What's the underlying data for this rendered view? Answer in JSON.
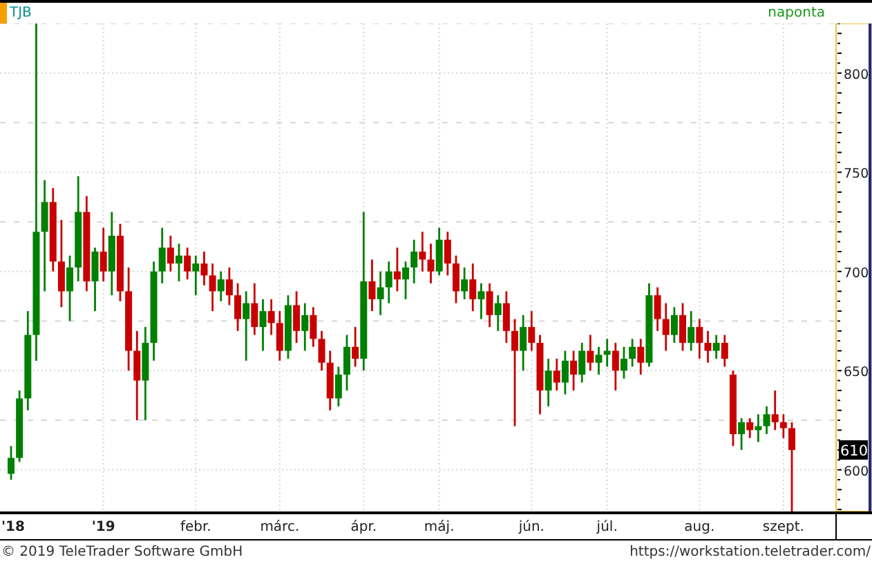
{
  "header": {
    "symbol": "TJB",
    "interval": "naponta"
  },
  "chart": {
    "chart_data": {
      "type": "candlestick",
      "grid": true,
      "ylim": [
        579,
        825
      ],
      "categories": [
        "'18",
        null,
        null,
        null,
        null,
        null,
        null,
        null,
        null,
        null,
        null,
        "'19",
        null,
        null,
        null,
        null,
        null,
        null,
        null,
        null,
        null,
        null,
        "febr.",
        null,
        null,
        null,
        null,
        null,
        null,
        null,
        null,
        null,
        "márc.",
        null,
        null,
        null,
        null,
        null,
        null,
        null,
        null,
        null,
        "ápr.",
        null,
        null,
        null,
        null,
        null,
        null,
        null,
        null,
        "máj.",
        null,
        null,
        null,
        null,
        null,
        null,
        null,
        null,
        null,
        null,
        "jún.",
        null,
        null,
        null,
        null,
        null,
        null,
        null,
        null,
        "júl.",
        null,
        null,
        null,
        null,
        null,
        null,
        null,
        null,
        null,
        null,
        "aug.",
        null,
        null,
        null,
        null,
        null,
        null,
        null,
        null,
        null,
        "szept.",
        null
      ],
      "yticks": [
        600,
        650,
        700,
        750,
        800
      ],
      "annotations": [
        "610"
      ],
      "ohlc": [
        [
          598,
          612,
          595,
          606
        ],
        [
          606,
          640,
          604,
          636
        ],
        [
          636,
          680,
          630,
          668
        ],
        [
          668,
          825,
          655,
          720
        ],
        [
          720,
          746,
          690,
          735
        ],
        [
          735,
          742,
          700,
          705
        ],
        [
          705,
          726,
          682,
          690
        ],
        [
          690,
          708,
          675,
          702
        ],
        [
          702,
          748,
          695,
          730
        ],
        [
          730,
          738,
          690,
          695
        ],
        [
          695,
          712,
          680,
          710
        ],
        [
          710,
          722,
          695,
          700
        ],
        [
          700,
          730,
          688,
          718
        ],
        [
          718,
          724,
          685,
          690
        ],
        [
          690,
          702,
          650,
          660
        ],
        [
          660,
          670,
          625,
          645
        ],
        [
          645,
          672,
          625,
          664
        ],
        [
          664,
          705,
          655,
          700
        ],
        [
          700,
          722,
          694,
          712
        ],
        [
          712,
          718,
          700,
          704
        ],
        [
          704,
          714,
          695,
          708
        ],
        [
          708,
          712,
          696,
          700
        ],
        [
          700,
          708,
          688,
          704
        ],
        [
          704,
          710,
          693,
          698
        ],
        [
          698,
          704,
          680,
          690
        ],
        [
          690,
          700,
          685,
          696
        ],
        [
          696,
          702,
          683,
          688
        ],
        [
          688,
          694,
          670,
          676
        ],
        [
          676,
          690,
          655,
          684
        ],
        [
          684,
          694,
          668,
          672
        ],
        [
          672,
          686,
          660,
          680
        ],
        [
          680,
          686,
          668,
          674
        ],
        [
          674,
          680,
          655,
          660
        ],
        [
          660,
          688,
          656,
          683
        ],
        [
          683,
          690,
          664,
          670
        ],
        [
          670,
          684,
          660,
          678
        ],
        [
          678,
          682,
          662,
          666
        ],
        [
          666,
          670,
          650,
          654
        ],
        [
          654,
          660,
          630,
          636
        ],
        [
          636,
          652,
          632,
          648
        ],
        [
          648,
          668,
          640,
          662
        ],
        [
          662,
          672,
          652,
          656
        ],
        [
          656,
          730,
          650,
          695
        ],
        [
          695,
          706,
          680,
          686
        ],
        [
          686,
          700,
          678,
          692
        ],
        [
          692,
          705,
          684,
          700
        ],
        [
          700,
          712,
          690,
          696
        ],
        [
          696,
          705,
          686,
          702
        ],
        [
          702,
          716,
          694,
          710
        ],
        [
          710,
          720,
          700,
          706
        ],
        [
          706,
          714,
          694,
          700
        ],
        [
          700,
          722,
          698,
          716
        ],
        [
          716,
          720,
          698,
          704
        ],
        [
          704,
          708,
          684,
          690
        ],
        [
          690,
          702,
          686,
          696
        ],
        [
          696,
          704,
          680,
          686
        ],
        [
          686,
          694,
          676,
          690
        ],
        [
          690,
          694,
          672,
          678
        ],
        [
          678,
          688,
          670,
          684
        ],
        [
          684,
          690,
          664,
          670
        ],
        [
          670,
          676,
          622,
          660
        ],
        [
          660,
          678,
          650,
          672
        ],
        [
          672,
          680,
          660,
          664
        ],
        [
          664,
          668,
          628,
          640
        ],
        [
          640,
          656,
          632,
          650
        ],
        [
          650,
          656,
          640,
          644
        ],
        [
          644,
          660,
          638,
          655
        ],
        [
          655,
          660,
          640,
          648
        ],
        [
          648,
          664,
          644,
          660
        ],
        [
          660,
          668,
          650,
          654
        ],
        [
          654,
          662,
          648,
          658
        ],
        [
          658,
          666,
          652,
          660
        ],
        [
          660,
          664,
          640,
          650
        ],
        [
          650,
          662,
          646,
          656
        ],
        [
          656,
          666,
          652,
          662
        ],
        [
          662,
          666,
          648,
          654
        ],
        [
          654,
          694,
          652,
          688
        ],
        [
          688,
          692,
          670,
          676
        ],
        [
          676,
          684,
          660,
          668
        ],
        [
          668,
          682,
          664,
          678
        ],
        [
          678,
          684,
          660,
          664
        ],
        [
          664,
          680,
          660,
          672
        ],
        [
          672,
          676,
          656,
          664
        ],
        [
          664,
          670,
          654,
          660
        ],
        [
          660,
          668,
          656,
          664
        ],
        [
          664,
          668,
          652,
          656
        ],
        [
          648,
          650,
          612,
          618
        ],
        [
          618,
          626,
          610,
          624
        ],
        [
          624,
          626,
          616,
          620
        ],
        [
          620,
          628,
          614,
          622
        ],
        [
          622,
          632,
          618,
          628
        ],
        [
          628,
          640,
          620,
          624
        ],
        [
          624,
          628,
          616,
          621
        ],
        [
          621,
          624,
          578,
          610
        ]
      ]
    }
  },
  "footer": {
    "copyright": "© 2019 TeleTrader Software GmbH",
    "url": "https://workstation.teletrader.com/"
  }
}
